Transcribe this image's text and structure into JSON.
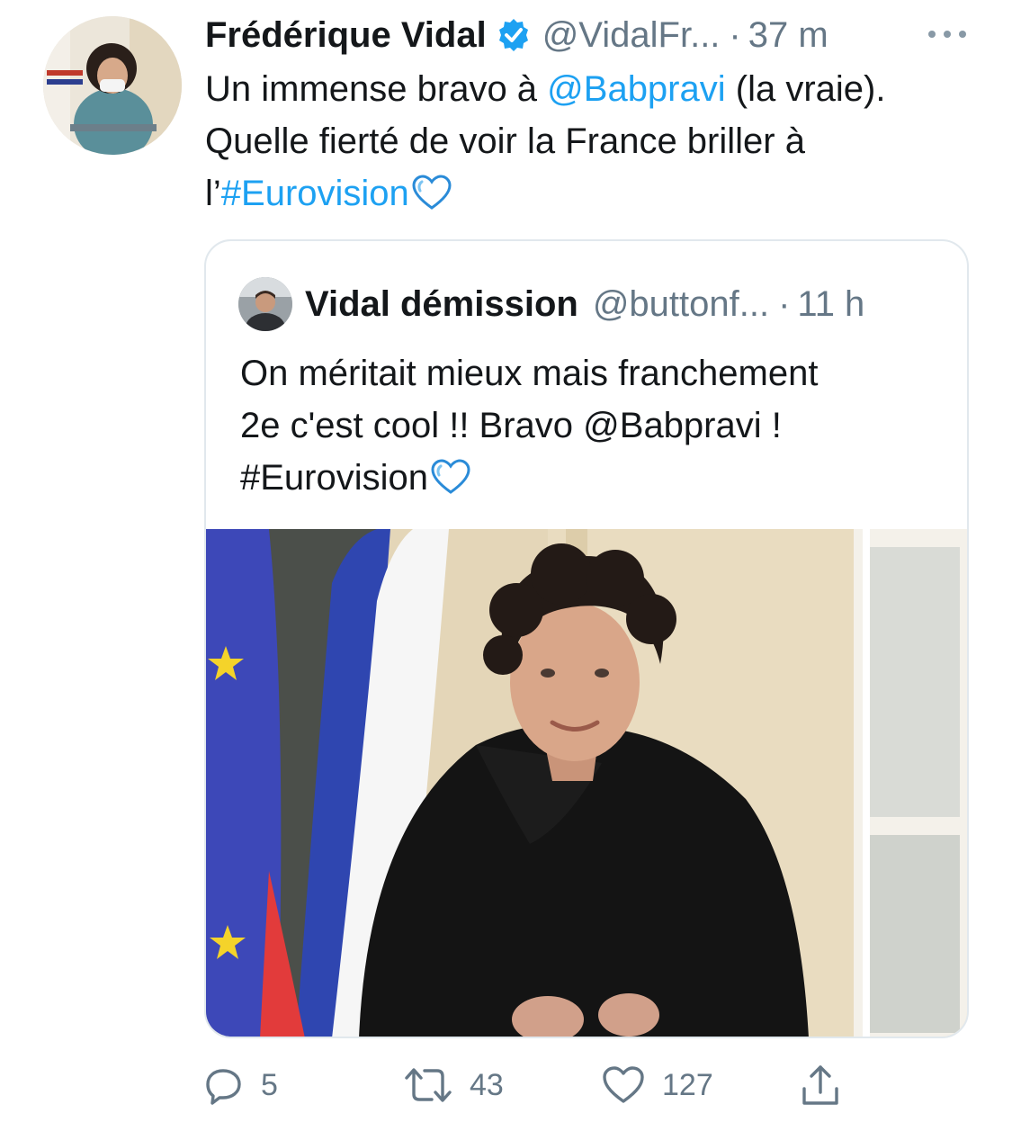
{
  "tweet": {
    "author_name": "Frédérique Vidal",
    "verified": true,
    "handle": "@VidalFr...",
    "separator": "·",
    "time": "37 m",
    "more_icon": "more-dots-icon",
    "text": {
      "part1": "Un immense bravo à ",
      "mention": "@Babpravi",
      "part2": " (la vraie). Quelle fierté de voir la France briller à l’",
      "hashtag": "#Eurovision"
    }
  },
  "quoted_tweet": {
    "author_name": "Vidal démission",
    "handle": "@buttonf...",
    "separator": "·",
    "time": "11 h",
    "text": {
      "line1": "On méritait mieux mais franchement",
      "line2": "2e c'est cool !! Bravo @Babpravi !",
      "hashtag": "#Eurovision"
    }
  },
  "actions": {
    "reply_count": "5",
    "retweet_count": "43",
    "like_count": "127"
  },
  "colors": {
    "accent": "#1da1f2",
    "secondary_text": "#657786",
    "border": "#e1e8ed"
  }
}
